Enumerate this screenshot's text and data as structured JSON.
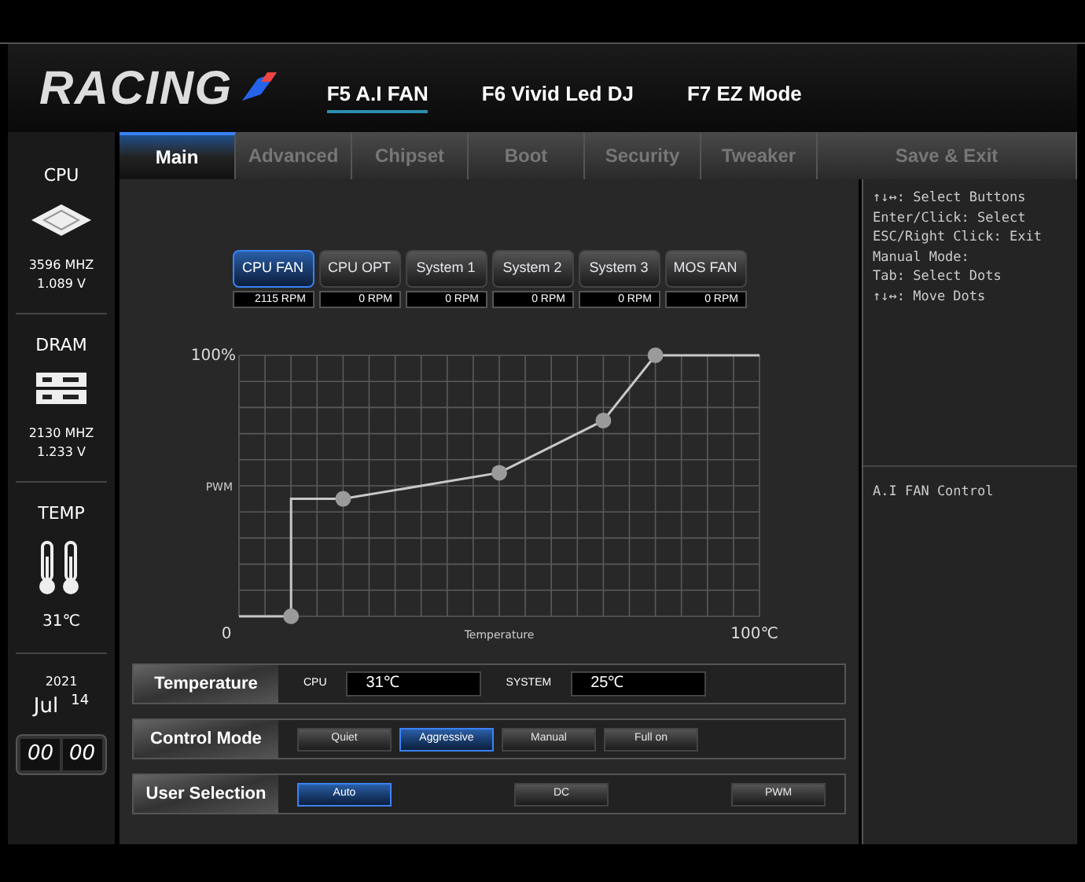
{
  "header": {
    "logo": "RACING",
    "hotkeys": [
      {
        "label": "F5 A.I FAN",
        "selected": true
      },
      {
        "label": "F6 Vivid Led DJ",
        "selected": false
      },
      {
        "label": "F7 EZ Mode",
        "selected": false
      }
    ]
  },
  "tabs": [
    {
      "label": "Main",
      "selected": true
    },
    {
      "label": "Advanced",
      "selected": false
    },
    {
      "label": "Chipset",
      "selected": false
    },
    {
      "label": "Boot",
      "selected": false
    },
    {
      "label": "Security",
      "selected": false
    },
    {
      "label": "Tweaker",
      "selected": false
    },
    {
      "label": "Save & Exit",
      "selected": false
    }
  ],
  "sidebar": {
    "cpu": {
      "title": "CPU",
      "frequency": "3596 MHZ",
      "voltage": "1.089 V"
    },
    "dram": {
      "title": "DRAM",
      "frequency": "2130 MHZ",
      "voltage": "1.233 V"
    },
    "temp": {
      "title": "TEMP",
      "value": "31℃"
    },
    "date": {
      "year": "2021",
      "month": "Jul",
      "day": "14"
    },
    "clock": {
      "hours": "00",
      "minutes": "00"
    }
  },
  "fans": [
    {
      "label": "CPU FAN",
      "reading": "2115 RPM",
      "selected": true
    },
    {
      "label": "CPU OPT",
      "reading": "0 RPM",
      "selected": false
    },
    {
      "label": "System 1",
      "reading": "0 RPM",
      "selected": false
    },
    {
      "label": "System 2",
      "reading": "0 RPM",
      "selected": false
    },
    {
      "label": "System 3",
      "reading": "0 RPM",
      "selected": false
    },
    {
      "label": "MOS FAN",
      "reading": "0 RPM",
      "selected": false
    }
  ],
  "fan_curve": {
    "x_label": "Temperature",
    "y_label": "PWM",
    "y_max_label": "100%",
    "x_min_label": "0",
    "x_max_label": "100℃"
  },
  "temperature": {
    "label": "Temperature",
    "cpu_label": "CPU",
    "cpu_value": "31℃",
    "system_label": "SYSTEM",
    "system_value": "25℃"
  },
  "control_mode": {
    "label": "Control Mode",
    "options": [
      {
        "label": "Quiet",
        "selected": false
      },
      {
        "label": "Aggressive",
        "selected": true
      },
      {
        "label": "Manual",
        "selected": false
      },
      {
        "label": "Full on",
        "selected": false
      }
    ]
  },
  "user_selection": {
    "label": "User Selection",
    "options": [
      {
        "label": "Auto",
        "selected": true
      },
      {
        "label": "DC",
        "selected": false
      },
      {
        "label": "PWM",
        "selected": false
      }
    ]
  },
  "help": {
    "lines": [
      "↑↓↔: Select Buttons",
      "Enter/Click: Select",
      "ESC/Right Click: Exit",
      "Manual Mode:",
      "Tab: Select Dots",
      "↑↓↔: Move Dots"
    ],
    "description": "A.I FAN Control"
  }
}
